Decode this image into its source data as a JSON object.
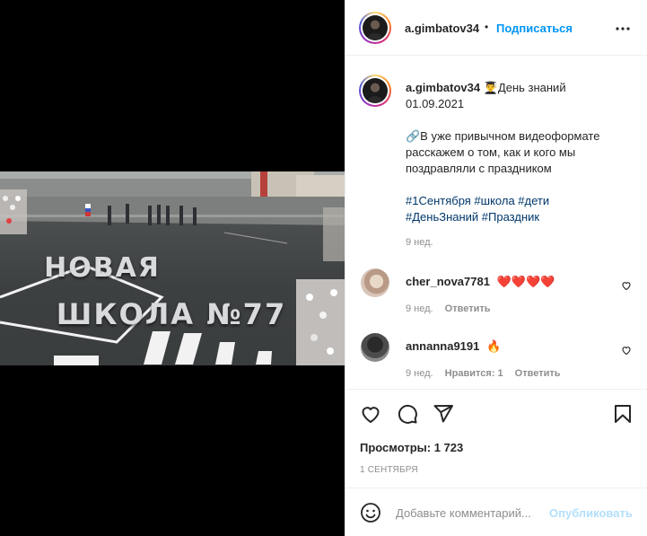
{
  "author": {
    "username": "a.gimbatov34",
    "follow_label": "Подписаться",
    "separator": "•"
  },
  "video": {
    "title_line1": "НОВАЯ",
    "title_line2": "ШКОЛА №77"
  },
  "caption": {
    "username": "a.gimbatov34",
    "line1": "👨‍🎓День знаний",
    "line2": "01.09.2021",
    "line3": "🔗В уже привычном видеоформате",
    "line4": "расскажем о том, как и кого мы",
    "line5": "поздравляли с праздником",
    "hashtags_line1": "#1Сентября #школа #дети",
    "hashtags_line2": "#ДеньЗнаний #Праздник",
    "time": "9 нед."
  },
  "comments": [
    {
      "username": "cher_nova7781",
      "text": "❤️❤️❤️❤️",
      "time": "9 нед.",
      "reply_label": "Ответить"
    },
    {
      "username": "annanna9191",
      "text": "🔥",
      "time": "9 нед.",
      "likes_label": "Нравится: 1",
      "reply_label": "Ответить"
    }
  ],
  "stats": {
    "views_label": "Просмотры: 1 723",
    "date": "1 СЕНТЯБРЯ"
  },
  "add_comment": {
    "placeholder": "Добавьте комментарий...",
    "post_label": "Опубликовать"
  },
  "icons": {
    "more": "more-horizontal-icon",
    "like": "heart-icon",
    "comment": "comment-bubble-icon",
    "share": "paper-plane-icon",
    "save": "bookmark-icon",
    "emoji": "emoji-smile-icon"
  },
  "colors": {
    "accent": "#0095f6",
    "post_disabled": "#b2dffc",
    "hashtag": "#00376b",
    "muted": "#8e8e8e"
  }
}
